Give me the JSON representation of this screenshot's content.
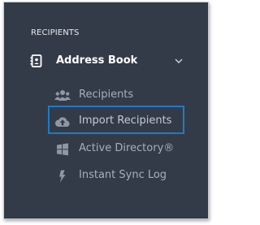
{
  "sidebar": {
    "section_label": "RECIPIENTS",
    "group": {
      "label": "Address Book",
      "icon": "address-book-icon",
      "expanded": true
    },
    "items": [
      {
        "label": "Recipients",
        "icon": "users-icon",
        "selected": false
      },
      {
        "label": "Import Recipients",
        "icon": "cloud-upload-icon",
        "selected": true
      },
      {
        "label": "Active Directory®",
        "icon": "windows-icon",
        "selected": false
      },
      {
        "label": "Instant Sync Log",
        "icon": "lightning-icon",
        "selected": false
      }
    ]
  },
  "colors": {
    "background": "#343b48",
    "text_primary": "#ffffff",
    "text_muted": "#a7afbb",
    "highlight_border": "#1f7ac6"
  }
}
